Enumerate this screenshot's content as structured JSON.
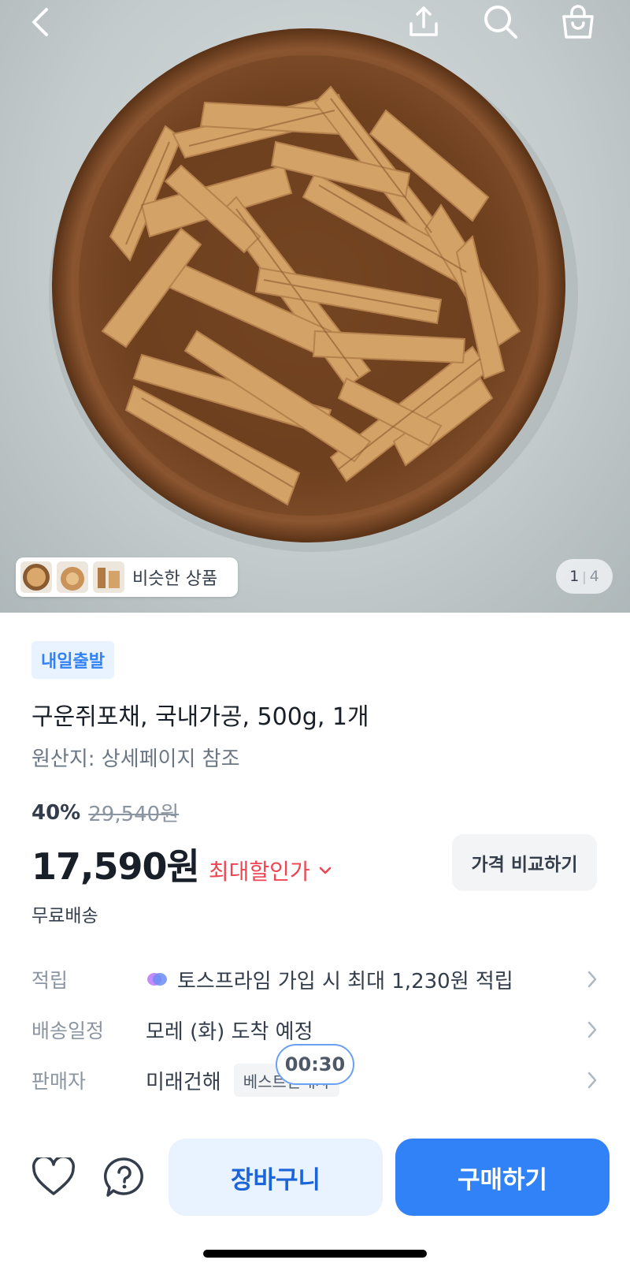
{
  "similar": {
    "label": "비슷한 상품"
  },
  "gallery": {
    "current": "1",
    "separator": "|",
    "total": "4"
  },
  "product": {
    "badge": "내일출발",
    "title": "구운쥐포채, 국내가공, 500g, 1개",
    "origin": "원산지: 상세페이지 참조",
    "discount_rate": "40%",
    "original_price": "29,540원",
    "price": "17,590원",
    "best_price_label": "최대할인가",
    "compare_label": "가격 비교하기",
    "shipping_fee": "무료배송"
  },
  "info": {
    "points_key": "적립",
    "points_value": "토스프라임 가입 시 최대 1,230원 적립",
    "delivery_key": "배송일정",
    "delivery_value": "모레 (화) 도착 예정",
    "seller_key": "판매자",
    "seller_value": "미래건해",
    "seller_badge": "베스트판매자"
  },
  "timer": "00:30",
  "actions": {
    "cart_label": "장바구니",
    "buy_label": "구매하기"
  },
  "colors": {
    "accent": "#3182f6",
    "sale": "#f04452",
    "badge_bg": "#e8f3ff"
  },
  "icons": [
    "back-icon",
    "share-icon",
    "search-icon",
    "shopping-bag-icon",
    "heart-icon",
    "question-icon",
    "chevron-right-icon",
    "chevron-down-icon",
    "toss-prime-icon"
  ]
}
